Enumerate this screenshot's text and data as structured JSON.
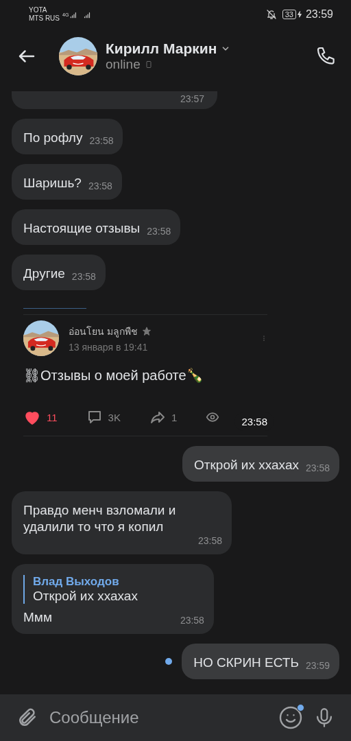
{
  "status_bar": {
    "carriers": [
      "YOTA",
      "MTS RUS"
    ],
    "network": "4G",
    "battery": "33",
    "time": "23:59"
  },
  "header": {
    "name": "Кирилл Маркин",
    "status": "online"
  },
  "messages": [
    {
      "kind": "partial",
      "outgoing": false,
      "time": "23:57"
    },
    {
      "kind": "text",
      "outgoing": false,
      "text": "По рофлу",
      "time": "23:58"
    },
    {
      "kind": "text",
      "outgoing": false,
      "text": "Шаришь?",
      "time": "23:58"
    },
    {
      "kind": "text",
      "outgoing": false,
      "text": "Настоящие отзывы",
      "time": "23:58"
    },
    {
      "kind": "text",
      "outgoing": false,
      "text": "Другие",
      "time": "23:58"
    },
    {
      "kind": "post",
      "outgoing": false,
      "author": "อ่อนโยน มลูกพืช",
      "date": "13 января в 19:41",
      "text": "⛓Отзывы о моей работе🍾",
      "likes": "11",
      "liked": true,
      "comments": "3K",
      "shares": "1",
      "time": "23:58"
    },
    {
      "kind": "text",
      "outgoing": true,
      "text": "Открой их ххахах",
      "time": "23:58",
      "unread": false
    },
    {
      "kind": "text",
      "outgoing": false,
      "text": "Правдо менч взломали и удалили то что я копил",
      "time": "23:58"
    },
    {
      "kind": "reply",
      "outgoing": false,
      "quote_author": "Влад Выходов",
      "quote_text": "Открой их ххахах",
      "text": "Ммм",
      "time": "23:58"
    },
    {
      "kind": "text",
      "outgoing": true,
      "text": "НО СКРИН ЕСТЬ",
      "time": "23:59",
      "unread": true
    }
  ],
  "composer": {
    "placeholder": "Сообщение",
    "emoji_badge": true
  }
}
